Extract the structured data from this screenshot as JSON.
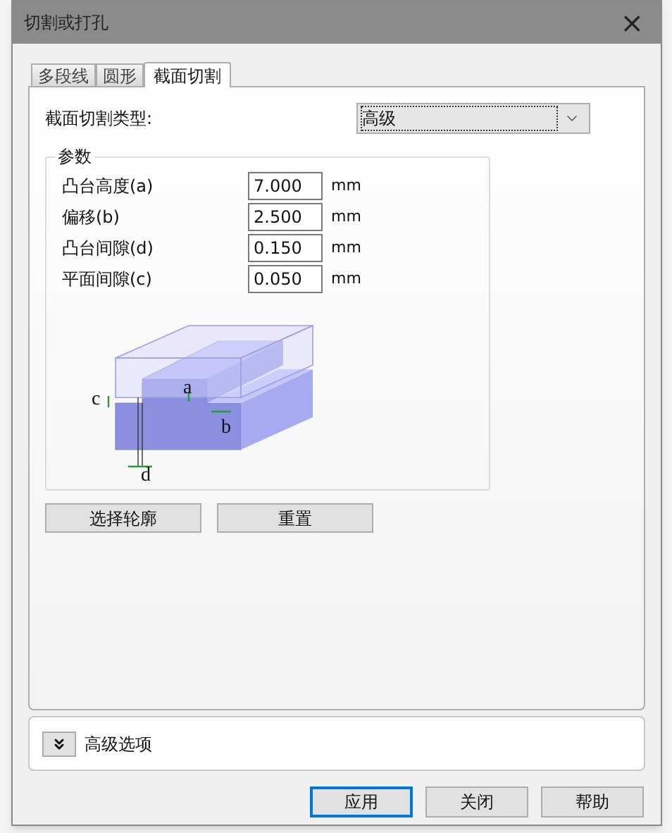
{
  "window": {
    "title": "切割或打孔",
    "close": "×"
  },
  "tabs": [
    {
      "label": "多段线",
      "selected": false
    },
    {
      "label": "圆形",
      "selected": false
    },
    {
      "label": "截面切割",
      "selected": true
    }
  ],
  "cut_type": {
    "label": "截面切割类型:",
    "value": "高级",
    "focused": true
  },
  "parameters": {
    "title": "参数",
    "fields": [
      {
        "label": "凸台高度(a)",
        "value": "7.000",
        "unit": "mm"
      },
      {
        "label": "偏移(b)",
        "value": "2.500",
        "unit": "mm"
      },
      {
        "label": "凸台间隙(d)",
        "value": "0.150",
        "unit": "mm"
      },
      {
        "label": "平面间隙(c)",
        "value": "0.050",
        "unit": "mm"
      }
    ],
    "diagram_labels": [
      "a",
      "b",
      "c",
      "d"
    ]
  },
  "panel_buttons": [
    "选择轮廓",
    "重置"
  ],
  "advanced": {
    "label": "高级选项",
    "expanded": false
  },
  "footer_buttons": [
    {
      "label": "应用",
      "default": true
    },
    {
      "label": "关闭",
      "default": false
    },
    {
      "label": "帮助",
      "default": false
    }
  ]
}
